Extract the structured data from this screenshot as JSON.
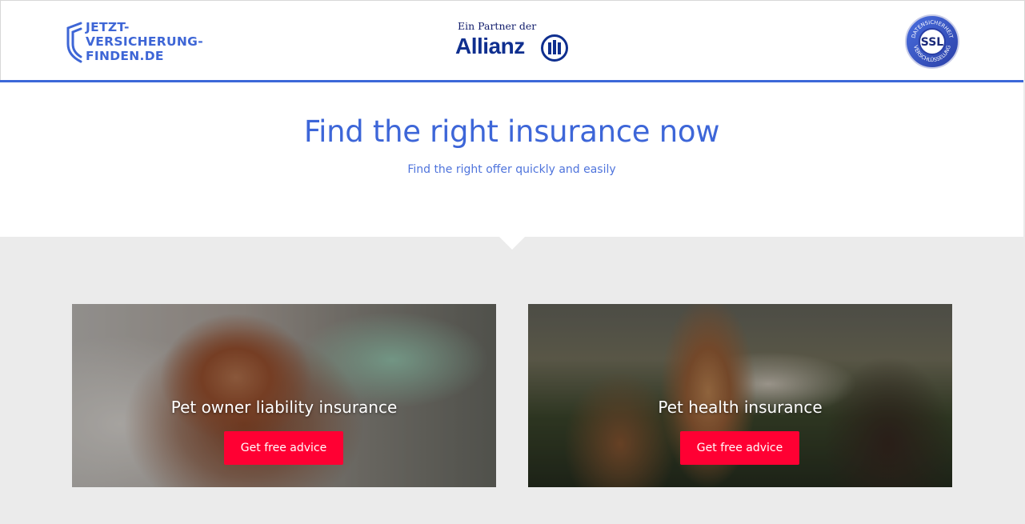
{
  "header": {
    "logo_lines": [
      "JETZT-",
      "VERSICHERUNG-",
      "FINDEN.DE"
    ],
    "partner_label": "Ein Partner der",
    "partner_name": "Allianz",
    "ssl_badge": {
      "center": "SSL",
      "top_arc": "DATENSICHERHEIT",
      "bottom_arc": "VERSCHLÜSSELUNG"
    }
  },
  "hero": {
    "title": "Find the right insurance now",
    "subtitle": "Find the right offer quickly and easily"
  },
  "cards": [
    {
      "title": "Pet owner liability insurance",
      "button_label": "Get free advice",
      "image": "puppy-photo"
    },
    {
      "title": "Pet health insurance",
      "button_label": "Get free advice",
      "image": "horses-photo"
    }
  ],
  "colors": {
    "brand_blue": "#3d66d8",
    "allianz_navy": "#0f2f8f",
    "cta_red": "#ff0033",
    "page_gray": "#ebebeb"
  }
}
